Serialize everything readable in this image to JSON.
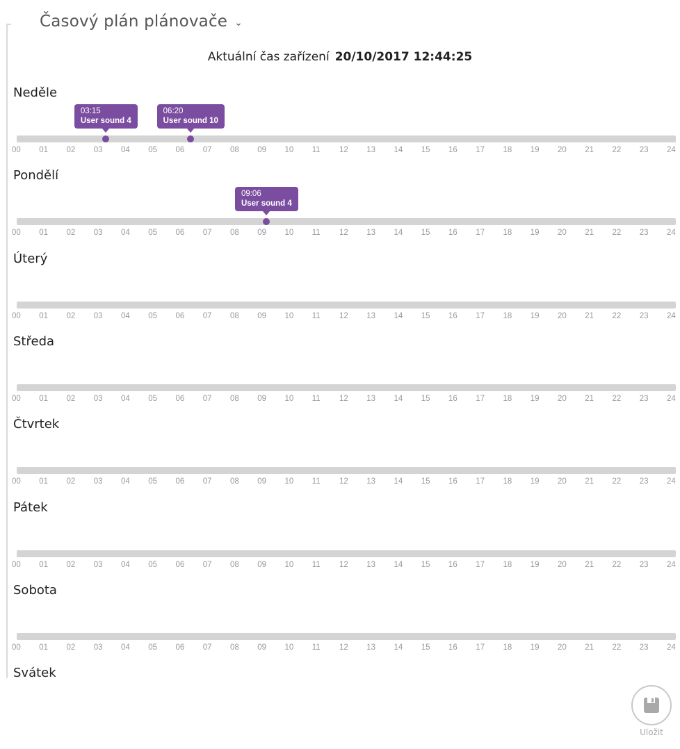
{
  "header": {
    "title": "Časový plán plánovače",
    "chevron_icon": "chevron-down-icon"
  },
  "device_time": {
    "label": "Aktuální čas zařízení",
    "value": "20/10/2017 12:44:25"
  },
  "hour_ticks": [
    "00",
    "01",
    "02",
    "03",
    "04",
    "05",
    "06",
    "07",
    "08",
    "09",
    "10",
    "11",
    "12",
    "13",
    "14",
    "15",
    "16",
    "17",
    "18",
    "19",
    "20",
    "21",
    "22",
    "23",
    "24"
  ],
  "days": [
    {
      "name": "Neděle",
      "events": [
        {
          "time": "03:15",
          "sound": "User sound 4"
        },
        {
          "time": "06:20",
          "sound": "User sound 10"
        }
      ]
    },
    {
      "name": "Pondělí",
      "events": [
        {
          "time": "09:06",
          "sound": "User sound 4"
        }
      ]
    },
    {
      "name": "Úterý",
      "events": []
    },
    {
      "name": "Středa",
      "events": []
    },
    {
      "name": "Čtvrtek",
      "events": []
    },
    {
      "name": "Pátek",
      "events": []
    },
    {
      "name": "Sobota",
      "events": []
    },
    {
      "name": "Svátek",
      "events": []
    }
  ],
  "save": {
    "label": "Uložit",
    "icon": "floppy-disk-icon"
  },
  "colors": {
    "accent": "#7b4da0",
    "track": "#d4d4d4",
    "tick": "#9a9a9a"
  }
}
